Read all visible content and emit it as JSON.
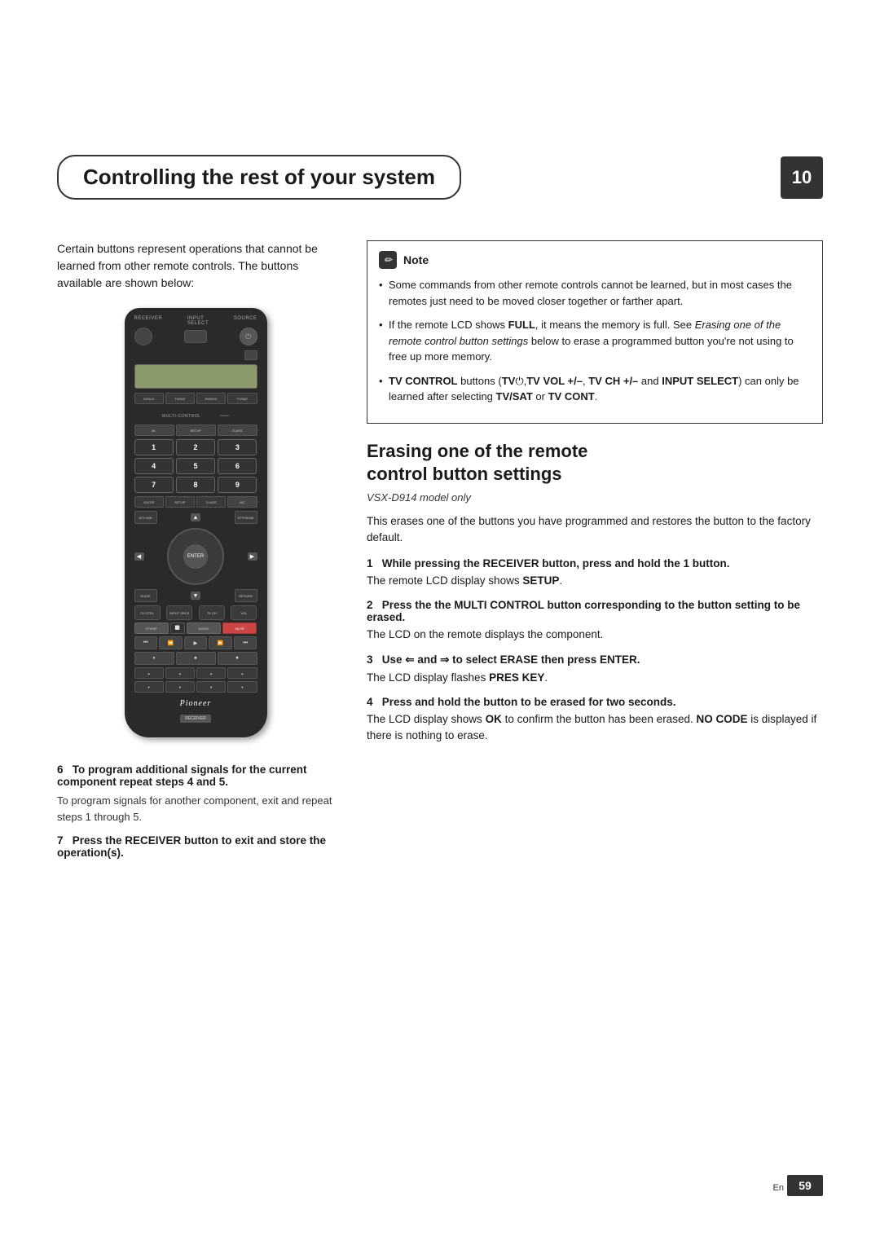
{
  "page": {
    "chapter_title": "Controlling the rest of your system",
    "chapter_number": "10",
    "page_number": "59",
    "page_lang": "En"
  },
  "left_column": {
    "intro_text": "Certain buttons represent operations that cannot be learned from other remote controls. The buttons available are shown below:"
  },
  "note_box": {
    "title": "Note",
    "items": [
      "Some commands from other remote controls cannot be learned, but in most cases the remotes just need to be moved closer together or farther apart.",
      "If the remote LCD shows FULL, it means the memory is full. See Erasing one of the remote control button settings below to erase a programmed button you're not using to free up more memory.",
      "TV CONTROL buttons (TV中, TV VOL +/–, TV CH +/– and INPUT SELECT) can only be learned after selecting TV/SAT or TV CONT."
    ]
  },
  "erase_section": {
    "title": "Erasing one of the remote control button settings",
    "subtitle": "VSX-D914 model only",
    "intro": "This erases one of the buttons you have programmed and restores the button to the factory default.",
    "steps": [
      {
        "number": "1",
        "heading": "While pressing the RECEIVER button, press and hold the 1 button.",
        "body": "The remote LCD display shows SETUP."
      },
      {
        "number": "2",
        "heading": "Press the the MULTI CONTROL button corresponding to the button setting to be erased.",
        "body": "The LCD on the remote displays the component."
      },
      {
        "number": "3",
        "heading": "Use ⇐ and ⇒ to select ERASE then press ENTER.",
        "body": "The LCD display flashes PRES KEY."
      },
      {
        "number": "4",
        "heading": "Press and hold the button to be erased for two seconds.",
        "body": "The LCD display shows OK to confirm the button has been erased. NO CODE is displayed if there is nothing to erase."
      }
    ]
  },
  "bottom_left": {
    "step6_heading": "6   To program additional signals for the current component repeat steps 4 and 5.",
    "step6_body": "To program signals for another component, exit and repeat steps 1 through 5.",
    "step7_heading": "7   Press the RECEIVER button to exit and store the operation(s)."
  },
  "remote": {
    "brand": "Pioneer",
    "label": "RECEIVER",
    "buttons": {
      "num_row1": [
        "1",
        "2",
        "3"
      ],
      "num_row2": [
        "4",
        "5",
        "6"
      ],
      "num_row3": [
        "7",
        "8",
        "9"
      ],
      "top_labels": [
        "RECEIVER",
        "INPUT SELECT",
        "SOURCE"
      ],
      "section_labels": [
        "DVDLD",
        "TV/SAT",
        "DVDIVC",
        "TV/SAT"
      ]
    }
  }
}
